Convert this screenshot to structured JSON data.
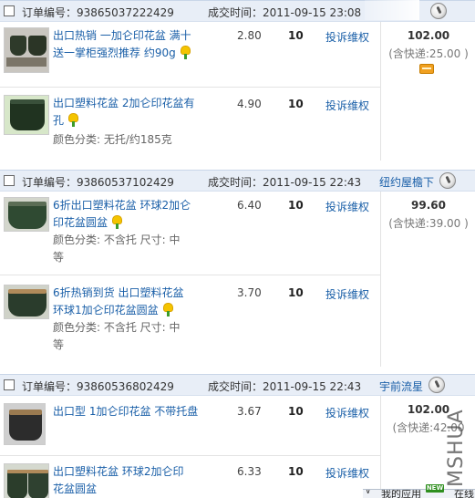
{
  "labels": {
    "order_no_prefix": "订单编号：",
    "deal_time_prefix": "成交时间：",
    "complain": "投诉维权"
  },
  "orders": [
    {
      "order_no": "订单编号：93865037222429",
      "deal_time": "成交时间：2011-09-15 23:08",
      "seller": "",
      "total": "102.00",
      "shipping": "(含快递:25.00 )",
      "items": [
        {
          "title": "出口热销 一加仑印花盆 满十送一掌柜强烈推荐 约90g",
          "sku": "",
          "price": "2.80",
          "qty": "10",
          "action": "投诉维权"
        },
        {
          "title": "出口塑料花盆 2加仑印花盆有孔",
          "sku": "颜色分类: 无托/约185克",
          "price": "4.90",
          "qty": "10",
          "action": "投诉维权"
        }
      ]
    },
    {
      "order_no": "订单编号：93860537102429",
      "deal_time": "成交时间：2011-09-15 22:43",
      "seller": "纽约屋檐下",
      "total": "99.60",
      "shipping": "(含快递:39.00 )",
      "items": [
        {
          "title": "6折出口塑料花盆 环球2加仑印花盆圆盆",
          "sku": "颜色分类: 不含托 尺寸: 中等",
          "price": "6.40",
          "qty": "10",
          "action": "投诉维权"
        },
        {
          "title": "6折热销到货 出口塑料花盆 环球1加仑印花盆圆盆",
          "sku": "颜色分类: 不含托 尺寸: 中等",
          "price": "3.70",
          "qty": "10",
          "action": "投诉维权"
        }
      ]
    },
    {
      "order_no": "订单编号：93860536802429",
      "deal_time": "成交时间：2011-09-15 22:43",
      "seller": "宇前流星",
      "total": "102.00",
      "shipping": "(含快递:42.00",
      "items": [
        {
          "title": "出口型 1加仑印花盆 不带托盘",
          "sku": "",
          "price": "3.67",
          "qty": "10",
          "action": "投诉维权"
        },
        {
          "title": "出口塑料花盆 环球2加仑印花盆圆盆",
          "sku": "",
          "price": "6.33",
          "qty": "10",
          "action": "投诉维权"
        }
      ]
    }
  ],
  "watermark": "MSHUA",
  "taskbar": {
    "new_badge": "NEW",
    "app_label": "我的应用",
    "app2_label": "在线"
  },
  "colors": {
    "header_bg": "#e8eef7",
    "link": "#1a5fa8",
    "tmall_yellow": "#f4c400"
  }
}
